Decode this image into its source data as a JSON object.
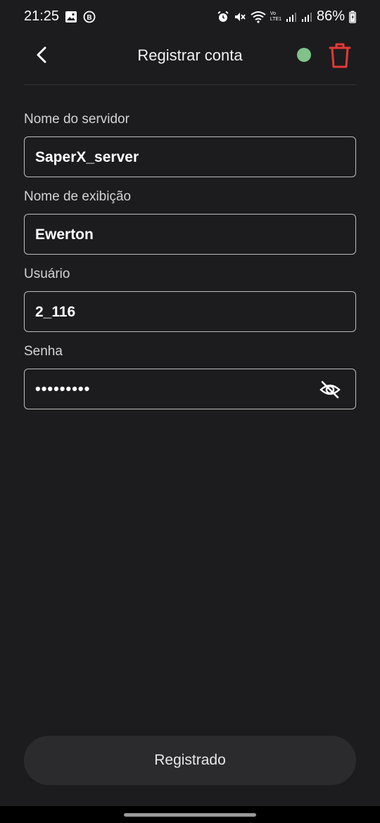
{
  "status": {
    "time": "21:25",
    "battery": "86%",
    "signal_tag": "Vo LTE1"
  },
  "header": {
    "title": "Registrar conta",
    "status_color": "#7fc28a",
    "delete_color": "#e53935"
  },
  "form": {
    "server_label": "Nome do servidor",
    "server_value": "SaperX_server",
    "display_label": "Nome de exibição",
    "display_value": "Ewerton",
    "user_label": "Usuário",
    "user_value": "2_116",
    "password_label": "Senha",
    "password_mask": "•••••••••"
  },
  "actions": {
    "register_label": "Registrado"
  },
  "icons": [
    "gallery-icon",
    "b-badge-icon",
    "alarm-icon",
    "mute-icon",
    "wifi-icon",
    "signal-icon",
    "battery-icon",
    "back-arrow-icon",
    "trash-icon",
    "eye-off-icon"
  ]
}
